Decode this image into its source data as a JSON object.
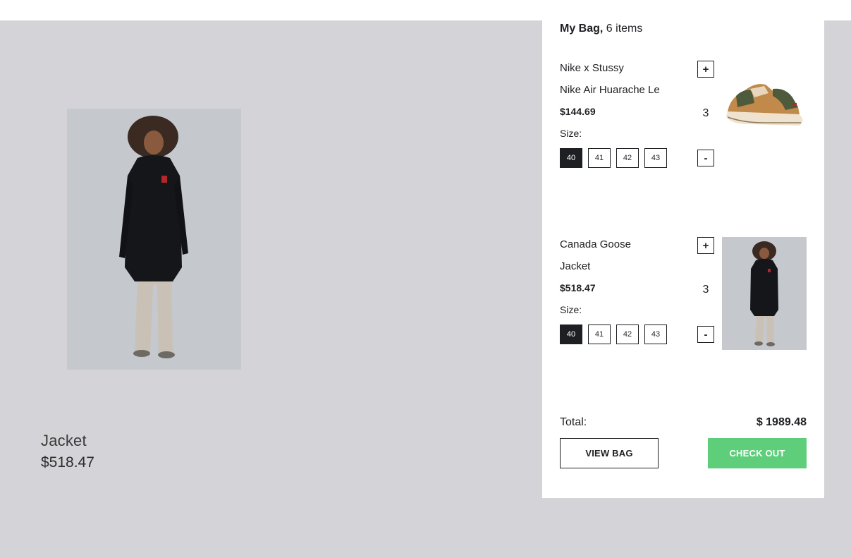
{
  "product": {
    "name": "Jacket",
    "price": "$518.47"
  },
  "cart": {
    "title_bold": "My Bag,",
    "title_count": " 6 items",
    "items": [
      {
        "brand": "Nike x Stussy",
        "name": "Nike Air Huarache Le",
        "price": "$144.69",
        "size_label": "Size:",
        "sizes": [
          "40",
          "41",
          "42",
          "43"
        ],
        "selected_size": "40",
        "quantity": "3",
        "plus_label": "+",
        "minus_label": "-"
      },
      {
        "brand": "Canada Goose",
        "name": "Jacket",
        "price": "$518.47",
        "size_label": "Size:",
        "sizes": [
          "40",
          "41",
          "42",
          "43"
        ],
        "selected_size": "40",
        "quantity": "3",
        "plus_label": "+",
        "minus_label": "-"
      }
    ],
    "total_label": "Total:",
    "total_value": "$ 1989.48",
    "view_bag_label": "VIEW BAG",
    "check_out_label": "CHECK OUT"
  },
  "colors": {
    "overlay": "#d4d4d8",
    "accent": "#5ece7b",
    "text": "#1d1f22"
  }
}
